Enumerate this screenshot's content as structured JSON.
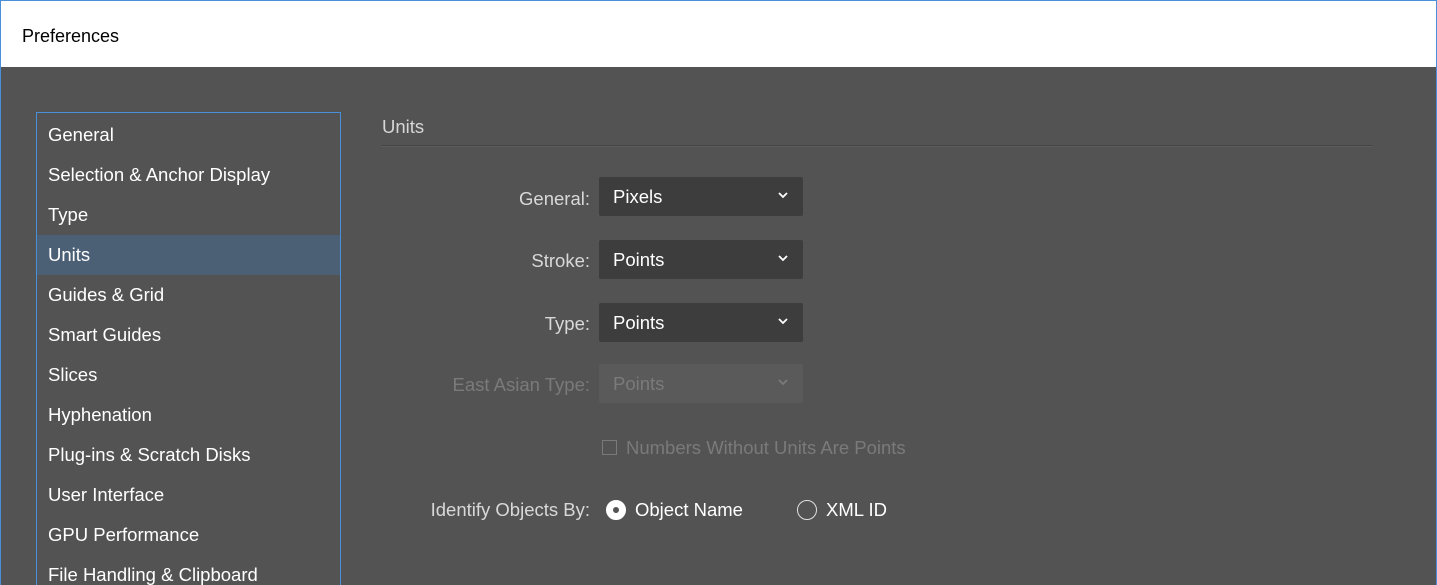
{
  "window": {
    "title": "Preferences"
  },
  "categories": [
    {
      "label": "General",
      "selected": false
    },
    {
      "label": "Selection & Anchor Display",
      "selected": false
    },
    {
      "label": "Type",
      "selected": false
    },
    {
      "label": "Units",
      "selected": true
    },
    {
      "label": "Guides & Grid",
      "selected": false
    },
    {
      "label": "Smart Guides",
      "selected": false
    },
    {
      "label": "Slices",
      "selected": false
    },
    {
      "label": "Hyphenation",
      "selected": false
    },
    {
      "label": "Plug-ins & Scratch Disks",
      "selected": false
    },
    {
      "label": "User Interface",
      "selected": false
    },
    {
      "label": "GPU Performance",
      "selected": false
    },
    {
      "label": "File Handling & Clipboard",
      "selected": false
    }
  ],
  "units": {
    "section_title": "Units",
    "general": {
      "label": "General:",
      "value": "Pixels"
    },
    "stroke": {
      "label": "Stroke:",
      "value": "Points"
    },
    "type": {
      "label": "Type:",
      "value": "Points"
    },
    "east_asian_type": {
      "label": "East Asian Type:",
      "value": "Points",
      "disabled": true
    },
    "numbers_without_units": {
      "label": "Numbers Without Units Are Points",
      "checked": false,
      "disabled": true
    },
    "identify_objects": {
      "label": "Identify Objects By:",
      "options": [
        {
          "label": "Object Name",
          "selected": true
        },
        {
          "label": "XML ID",
          "selected": false
        }
      ]
    }
  },
  "colors": {
    "background": "#535353",
    "selection": "#4b6075",
    "focus_border": "#4a90d9",
    "dropdown": "#3d3d3d"
  }
}
